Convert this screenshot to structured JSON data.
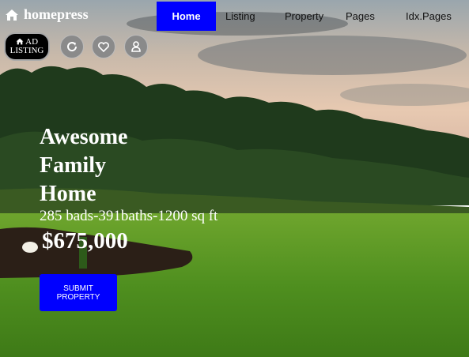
{
  "brand": {
    "name": "homepress",
    "icon": "home-icon"
  },
  "nav": {
    "items": [
      {
        "label": "Home",
        "active": true
      },
      {
        "label": "Listing",
        "active": false
      },
      {
        "label": "Property",
        "active": false
      },
      {
        "label": "Pages",
        "active": false
      },
      {
        "label": "Idx.Pages",
        "active": false
      }
    ]
  },
  "toolbar": {
    "ad_listing": {
      "line1": "AD",
      "line2": "LISTING",
      "icon": "home-icon"
    },
    "icons": [
      "refresh-icon",
      "heart-icon",
      "user-icon"
    ]
  },
  "hero": {
    "title_lines": [
      "Awesome",
      "Family",
      "Home"
    ],
    "specs": "285 bads-391baths-1200 sq ft",
    "price": "$675,000",
    "cta": "SUBMIT PROPERTY"
  },
  "colors": {
    "accent": "#0000ff",
    "text_on_hero": "#ffffff"
  }
}
